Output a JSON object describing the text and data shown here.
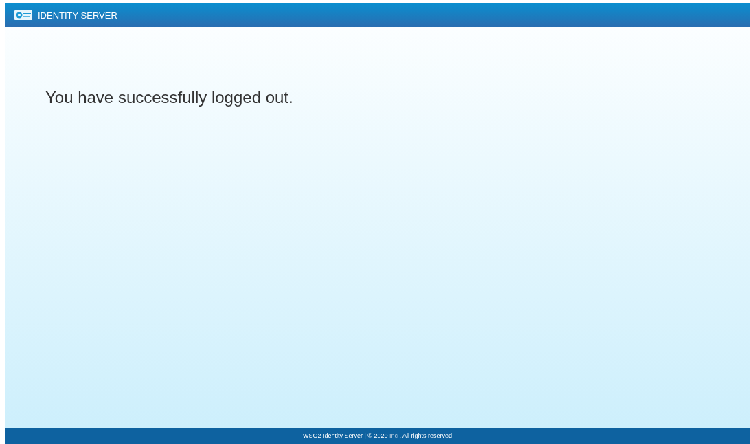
{
  "header": {
    "title": "IDENTITY SERVER"
  },
  "message": "You have successfully logged out.",
  "footer": {
    "prefix": "WSO2 Identity Server | © 2020",
    "link": "Inc",
    "suffix": ". All rights reserved"
  }
}
